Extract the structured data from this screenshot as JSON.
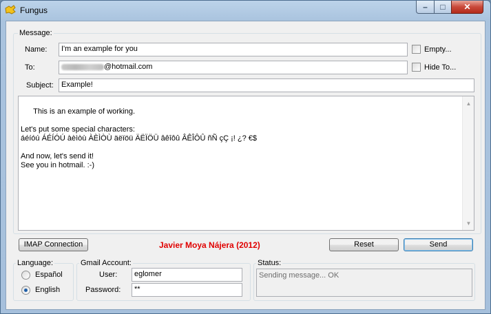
{
  "window": {
    "title": "Fungus",
    "controls": {
      "minimize": "–",
      "maximize": "□",
      "close": "✕"
    }
  },
  "message_group": {
    "label": "Message:",
    "name_label": "Name:",
    "name_value": "I'm an example for you",
    "to_label": "To:",
    "to_value_suffix": "@hotmail.com",
    "subject_label": "Subject:",
    "subject_value": "Example!",
    "empty_checkbox": {
      "label": "Empty...",
      "checked": false
    },
    "hide_to_checkbox": {
      "label": "Hide To...",
      "checked": false
    },
    "body_text": "This is an example of working.\n\nLet's put some special characters:\náéíóú ÁÉÍÓÚ àèìòù ÀÈÌÒÙ äëïöü ÄËÏÖÜ âêîôû ÂÊÎÔÛ ñÑ çÇ ¡! ¿? €$\n\nAnd now, let's send it!\nSee you in hotmail. :-)"
  },
  "actions": {
    "imap_button": "IMAP Connection",
    "credit": "Javier Moya Nájera (2012)",
    "reset_button": "Reset",
    "send_button": "Send"
  },
  "language_group": {
    "label": "Language:",
    "options": [
      {
        "label": "Español",
        "selected": false
      },
      {
        "label": "English",
        "selected": true
      }
    ]
  },
  "gmail_group": {
    "label": "Gmail Account:",
    "user_label": "User:",
    "user_value": "eglomer",
    "password_label": "Password:",
    "password_value": "**"
  },
  "status_group": {
    "label": "Status:",
    "text": "Sending message... OK"
  },
  "colors": {
    "credit": "#e00000",
    "title_bar": "#a9c3de",
    "close_button": "#c9493a"
  }
}
